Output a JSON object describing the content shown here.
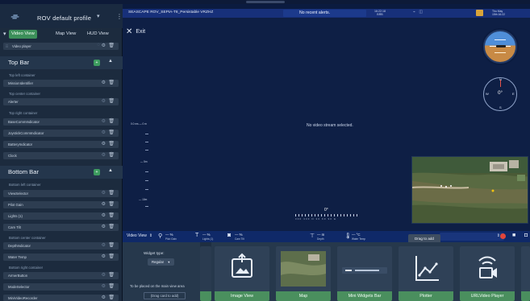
{
  "sidebar": {
    "profile_name": "ROV default profile",
    "tabs": [
      "Video View",
      "Map View",
      "HUD View"
    ],
    "active_tab": "Video View",
    "video_player_label": "Video player",
    "sections": {
      "top_bar": {
        "title": "Top Bar",
        "badge": "+",
        "left_container_label": "Top left container",
        "left_items": [
          "MissionIdentifier"
        ],
        "center_container_label": "Top center container",
        "center_items": [
          "Alerter"
        ],
        "right_container_label": "Top right container",
        "right_items": [
          "BaseCommIndicator",
          "JoystickCommIndicator",
          "BatteryIndicator",
          "Clock"
        ]
      },
      "bottom_bar": {
        "title": "Bottom Bar",
        "badge": "+",
        "left_container_label": "Bottom left container",
        "left_items": [
          "ViewSelector",
          "Pilot Gain",
          "Lights (1)",
          "Cam Tilt"
        ],
        "center_container_label": "Bottom center container",
        "center_items": [
          "DepthIndicator",
          "Water Temp"
        ],
        "right_container_label": "Bottom right container",
        "right_items": [
          "ArmerButton",
          "ModeSelector",
          "MiniVideoRecorder"
        ]
      }
    }
  },
  "topbar": {
    "vehicle_name": "SEASCAPE ROV_SEPIA-T8_Persistable VRZHZ",
    "alerts": "No recent alerts.",
    "time_line1": "16:22:18",
    "time_line2": "BRB",
    "right_status_line1": "Thu May",
    "right_status_line2": "15th 16:22"
  },
  "video": {
    "exit_label": "Exit",
    "no_video_text": "No video stream selected.",
    "compass_heading": "0°",
    "heading_value": "0°",
    "depth_top_label": "0.0 ms — 0 m",
    "depth_labels": [
      "— 5m",
      "— 10m"
    ],
    "heading_scale_text": "300 330 N 30 60 90 E"
  },
  "bottombar": {
    "view_selector": "Video View",
    "widgets": [
      {
        "icon": "pilot-gain",
        "value": "— %",
        "name": "Pilot Gain"
      },
      {
        "icon": "lights",
        "value": "— %",
        "name": "Lights (1)"
      },
      {
        "icon": "camera",
        "value": "— %",
        "name": "Cam Tilt"
      },
      {
        "icon": "depth",
        "value": "— m",
        "name": "Depth"
      },
      {
        "icon": "thermometer",
        "value": "— °C",
        "name": "Water Temp"
      }
    ],
    "drag_tooltip": "Drag to add"
  },
  "edit_menu": {
    "widget_type_label": "Widget type:",
    "widget_type_value": "Regular",
    "placement_note": "To be placed on the main view area",
    "drag_hint": "(Drag card to add)",
    "cards": [
      "Image View",
      "Map",
      "Mini Widgets Bar",
      "Plotter",
      "URLVideo Player"
    ]
  },
  "colors": {
    "accent_green": "#3c8f5a",
    "topbar_blue": "#17307a",
    "record_red": "#e0453b"
  }
}
